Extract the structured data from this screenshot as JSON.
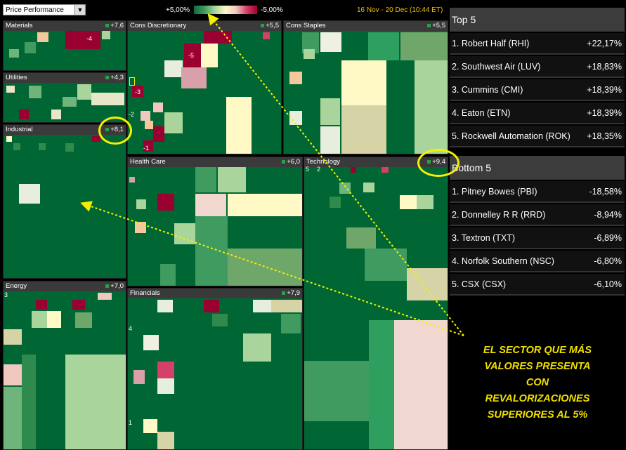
{
  "toolbar": {
    "dropdown_value": "Price Performance",
    "scale_high": "+5,00%",
    "scale_low": "-5,00%",
    "date_range": "16 Nov - 20 Dec (10:44 ET)"
  },
  "sectors": {
    "materials": {
      "name": "Materials",
      "value": "+7,6",
      "cell_label": "-4"
    },
    "cons_disc": {
      "name": "Cons Discretionary",
      "value": "+5,5",
      "labels": [
        "-5",
        "-3",
        "-2",
        "-1"
      ]
    },
    "cons_staples": {
      "name": "Cons Staples",
      "value": "+5,5"
    },
    "utilities": {
      "name": "Utilities",
      "value": "+4,3"
    },
    "industrial": {
      "name": "Industrial",
      "value": "+8,1"
    },
    "health_care": {
      "name": "Health Care",
      "value": "+6,0"
    },
    "technology": {
      "name": "Technology",
      "value": "+9,4",
      "labels": [
        "5",
        "2"
      ]
    },
    "energy": {
      "name": "Energy",
      "value": "+7,0",
      "labels": [
        "3"
      ]
    },
    "financials": {
      "name": "Financials",
      "value": "+7,9",
      "labels": [
        "4",
        "1"
      ]
    }
  },
  "top5": {
    "title": "Top 5",
    "items": [
      {
        "name": "1. Robert Half (RHI)",
        "value": "+22,17%"
      },
      {
        "name": "2. Southwest Air (LUV)",
        "value": "+18,83%"
      },
      {
        "name": "3. Cummins (CMI)",
        "value": "+18,39%"
      },
      {
        "name": "4. Eaton (ETN)",
        "value": "+18,39%"
      },
      {
        "name": "5. Rockwell Automation (ROK)",
        "value": "+18,35%"
      }
    ]
  },
  "bottom5": {
    "title": "Bottom 5",
    "items": [
      {
        "name": "1. Pitney Bowes (PBI)",
        "value": "-18,58%"
      },
      {
        "name": "2. Donnelley R R (RRD)",
        "value": "-8,94%"
      },
      {
        "name": "3. Textron (TXT)",
        "value": "-6,89%"
      },
      {
        "name": "4. Norfolk Southern (NSC)",
        "value": "-6,80%"
      },
      {
        "name": "5. CSX (CSX)",
        "value": "-6,10%"
      }
    ]
  },
  "annotation": {
    "lines": [
      "EL SECTOR QUE MÁS",
      "VALORES PRESENTA",
      "CON",
      "REVALORIZACIONES",
      "SUPERIORES AL 5%"
    ],
    "color": "#f0e000"
  },
  "colors": {
    "strong_up": "#006633",
    "down": "#9a0030",
    "neutral": "#fff9c6"
  }
}
